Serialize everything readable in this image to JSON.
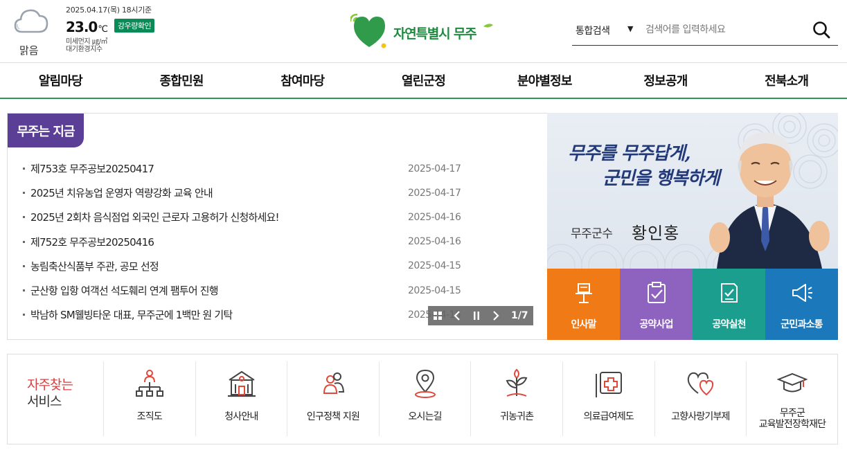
{
  "weather": {
    "icon": "cloud-icon",
    "state": "맑음",
    "date": "2025.04.17(목) 18시기준",
    "temp": "23.0",
    "unit": "℃",
    "rain_button": "강우량확인",
    "dust_line1": "미세먼지 ㎍/㎥",
    "dust_line2": "대기환경지수"
  },
  "logo": {
    "text": "자연특별시 무주"
  },
  "search": {
    "scope": "통합검색",
    "placeholder": "검색어를 입력하세요",
    "icon": "search-icon"
  },
  "gnb": [
    "알림마당",
    "종합민원",
    "참여마당",
    "열린군정",
    "분야별정보",
    "정보공개",
    "전북소개"
  ],
  "news": {
    "tab": "무주는 지금",
    "items": [
      {
        "title": "제753호 무주공보20250417",
        "date": "2025-04-17"
      },
      {
        "title": "2025년 치유농업 운영자 역량강화 교육 안내",
        "date": "2025-04-17"
      },
      {
        "title": "2025년 2회차 음식점업 외국인 근로자 고용허가 신청하세요!",
        "date": "2025-04-16"
      },
      {
        "title": "제752호 무주공보20250416",
        "date": "2025-04-16"
      },
      {
        "title": "농림축산식품부 주관, 공모 선정",
        "date": "2025-04-15"
      },
      {
        "title": "군산항 입항 여객선 석도훼리 연계 팸투어 진행",
        "date": "2025-04-15"
      },
      {
        "title": "박남하 SM웰빙타운 대표, 무주군에 1백만 원 기탁",
        "date": "2025-04-15"
      }
    ],
    "page": "1/7"
  },
  "mayor": {
    "slogan_line1": "무주를 무주답게,",
    "slogan_line2": "군민을 행복하게",
    "title": "무주군수",
    "name": "황인홍"
  },
  "quick_links": [
    {
      "label": "인사말",
      "icon": "podium-icon",
      "color": "#ef7a16"
    },
    {
      "label": "공약사업",
      "icon": "checklist-icon",
      "color": "#8e63bf"
    },
    {
      "label": "공약실천",
      "icon": "document-check-icon",
      "color": "#1b9e8e"
    },
    {
      "label": "군민과소통",
      "icon": "megaphone-icon",
      "color": "#1a78bb"
    }
  ],
  "services": {
    "heading_line1": "자주찾는",
    "heading_line2": "서비스",
    "items": [
      {
        "label": "조직도",
        "icon": "org-chart-icon"
      },
      {
        "label": "청사안내",
        "icon": "building-icon"
      },
      {
        "label": "인구정책 지원",
        "icon": "people-icon"
      },
      {
        "label": "오시는길",
        "icon": "location-pin-icon"
      },
      {
        "label": "귀농귀촌",
        "icon": "sprout-icon"
      },
      {
        "label": "의료급여제도",
        "icon": "medical-cross-icon"
      },
      {
        "label": "고향사랑기부제",
        "icon": "hearts-icon"
      },
      {
        "label": "무주군\n교육발전장학재단",
        "icon": "graduation-cap-icon"
      }
    ]
  },
  "colors": {
    "brand_green": "#2a9652",
    "news_purple": "#5b3f96",
    "accent_red": "#d64040"
  }
}
